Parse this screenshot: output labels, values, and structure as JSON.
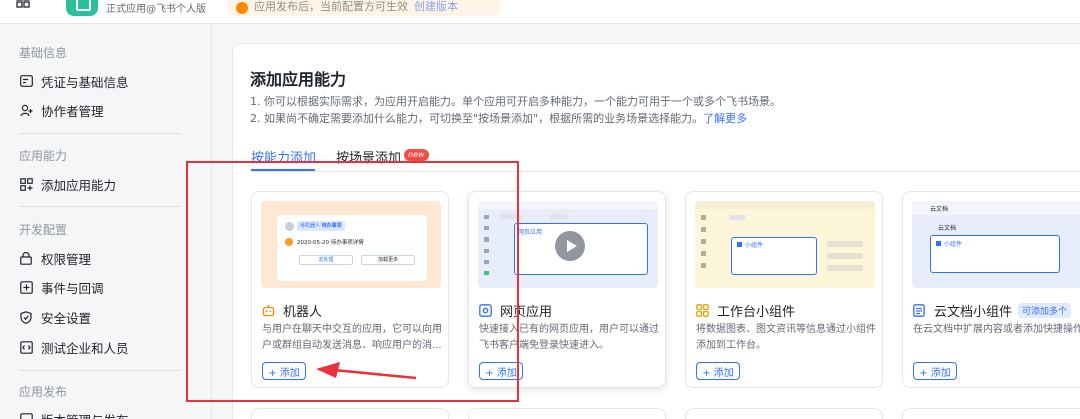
{
  "header": {
    "app_subtitle": "正式应用@飞书个人版",
    "notice_text": "应用发布后，当前配置方可生效",
    "notice_link": "创建版本"
  },
  "sidebar": {
    "sections": [
      {
        "title": "基础信息",
        "items": [
          {
            "label": "凭证与基础信息",
            "icon": "credentials-icon"
          },
          {
            "label": "协作者管理",
            "icon": "add-user-icon"
          }
        ]
      },
      {
        "title": "应用能力",
        "items": [
          {
            "label": "添加应用能力",
            "icon": "apps-grid-icon"
          }
        ]
      },
      {
        "title": "开发配置",
        "items": [
          {
            "label": "权限管理",
            "icon": "lock-icon"
          },
          {
            "label": "事件与回调",
            "icon": "event-icon"
          },
          {
            "label": "安全设置",
            "icon": "shield-icon"
          },
          {
            "label": "测试企业和人员",
            "icon": "test-icon"
          }
        ]
      },
      {
        "title": "应用发布",
        "items": [
          {
            "label": "版本管理与发布",
            "icon": "version-icon"
          }
        ]
      }
    ]
  },
  "main": {
    "title": "添加应用能力",
    "desc1": "1. 你可以根据实际需求，为应用开启能力。单个应用可开启多种能力，一个能力可用于一个或多个飞书场景。",
    "desc2": "2. 如果尚不确定需要添加什么能力，可切换至\"按场景添加\"，根据所需的业务场景选择能力。",
    "desc2_link": "了解更多",
    "tabs": [
      {
        "label": "按能力添加",
        "active": true
      },
      {
        "label": "按场景添加",
        "badge": "new"
      }
    ],
    "cards": [
      {
        "title": "机器人",
        "desc": "与用户在聊天中交互的应用，它可以向用户或群组自动发送消息、响应用户的消...",
        "button": "+ 添加",
        "preview_chip": "待办事项",
        "preview_chip_prefix": "待机器人",
        "preview_line": "2020-05-20 待办事项详情",
        "preview_btn1": "去处理",
        "preview_btn2": "加载更多"
      },
      {
        "title": "网页应用",
        "desc": "快速接入已有的网页应用，用户可以通过飞书客户端免登录快速进入。",
        "button": "+ 添加",
        "preview_label": "网页应用"
      },
      {
        "title": "工作台小组件",
        "desc": "将数据图表、图文资讯等信息通过小组件添加到工作台。",
        "button": "+ 添加",
        "preview_label": "小组件"
      },
      {
        "title": "云文档小组件",
        "badge": "可添加多个",
        "desc": "在云文档中扩展内容或者添加快捷操作。",
        "button": "+ 添加",
        "preview_header": "云文档",
        "preview_sub": "云文档",
        "preview_label": "小组件"
      }
    ]
  },
  "colors": {
    "accent": "#3370ff",
    "annotation_red": "#e8313b",
    "badge_red": "#f54a45"
  }
}
